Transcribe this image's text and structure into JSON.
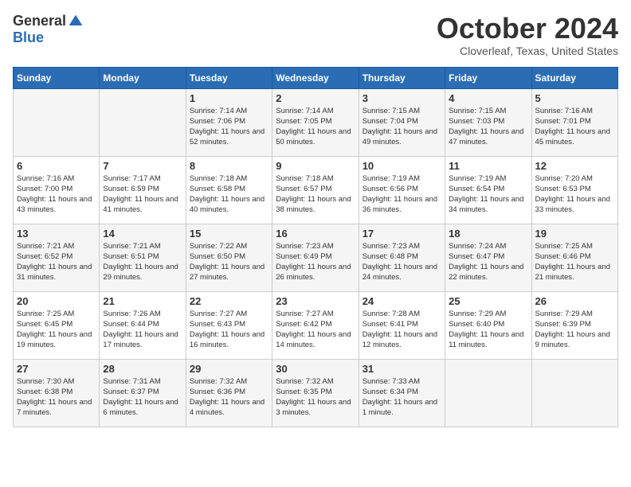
{
  "header": {
    "logo_general": "General",
    "logo_blue": "Blue",
    "month_title": "October 2024",
    "location": "Cloverleaf, Texas, United States"
  },
  "days_of_week": [
    "Sunday",
    "Monday",
    "Tuesday",
    "Wednesday",
    "Thursday",
    "Friday",
    "Saturday"
  ],
  "weeks": [
    [
      {
        "day": "",
        "info": ""
      },
      {
        "day": "",
        "info": ""
      },
      {
        "day": "1",
        "info": "Sunrise: 7:14 AM\nSunset: 7:06 PM\nDaylight: 11 hours and 52 minutes."
      },
      {
        "day": "2",
        "info": "Sunrise: 7:14 AM\nSunset: 7:05 PM\nDaylight: 11 hours and 50 minutes."
      },
      {
        "day": "3",
        "info": "Sunrise: 7:15 AM\nSunset: 7:04 PM\nDaylight: 11 hours and 49 minutes."
      },
      {
        "day": "4",
        "info": "Sunrise: 7:15 AM\nSunset: 7:03 PM\nDaylight: 11 hours and 47 minutes."
      },
      {
        "day": "5",
        "info": "Sunrise: 7:16 AM\nSunset: 7:01 PM\nDaylight: 11 hours and 45 minutes."
      }
    ],
    [
      {
        "day": "6",
        "info": "Sunrise: 7:16 AM\nSunset: 7:00 PM\nDaylight: 11 hours and 43 minutes."
      },
      {
        "day": "7",
        "info": "Sunrise: 7:17 AM\nSunset: 6:59 PM\nDaylight: 11 hours and 41 minutes."
      },
      {
        "day": "8",
        "info": "Sunrise: 7:18 AM\nSunset: 6:58 PM\nDaylight: 11 hours and 40 minutes."
      },
      {
        "day": "9",
        "info": "Sunrise: 7:18 AM\nSunset: 6:57 PM\nDaylight: 11 hours and 38 minutes."
      },
      {
        "day": "10",
        "info": "Sunrise: 7:19 AM\nSunset: 6:56 PM\nDaylight: 11 hours and 36 minutes."
      },
      {
        "day": "11",
        "info": "Sunrise: 7:19 AM\nSunset: 6:54 PM\nDaylight: 11 hours and 34 minutes."
      },
      {
        "day": "12",
        "info": "Sunrise: 7:20 AM\nSunset: 6:53 PM\nDaylight: 11 hours and 33 minutes."
      }
    ],
    [
      {
        "day": "13",
        "info": "Sunrise: 7:21 AM\nSunset: 6:52 PM\nDaylight: 11 hours and 31 minutes."
      },
      {
        "day": "14",
        "info": "Sunrise: 7:21 AM\nSunset: 6:51 PM\nDaylight: 11 hours and 29 minutes."
      },
      {
        "day": "15",
        "info": "Sunrise: 7:22 AM\nSunset: 6:50 PM\nDaylight: 11 hours and 27 minutes."
      },
      {
        "day": "16",
        "info": "Sunrise: 7:23 AM\nSunset: 6:49 PM\nDaylight: 11 hours and 26 minutes."
      },
      {
        "day": "17",
        "info": "Sunrise: 7:23 AM\nSunset: 6:48 PM\nDaylight: 11 hours and 24 minutes."
      },
      {
        "day": "18",
        "info": "Sunrise: 7:24 AM\nSunset: 6:47 PM\nDaylight: 11 hours and 22 minutes."
      },
      {
        "day": "19",
        "info": "Sunrise: 7:25 AM\nSunset: 6:46 PM\nDaylight: 11 hours and 21 minutes."
      }
    ],
    [
      {
        "day": "20",
        "info": "Sunrise: 7:25 AM\nSunset: 6:45 PM\nDaylight: 11 hours and 19 minutes."
      },
      {
        "day": "21",
        "info": "Sunrise: 7:26 AM\nSunset: 6:44 PM\nDaylight: 11 hours and 17 minutes."
      },
      {
        "day": "22",
        "info": "Sunrise: 7:27 AM\nSunset: 6:43 PM\nDaylight: 11 hours and 16 minutes."
      },
      {
        "day": "23",
        "info": "Sunrise: 7:27 AM\nSunset: 6:42 PM\nDaylight: 11 hours and 14 minutes."
      },
      {
        "day": "24",
        "info": "Sunrise: 7:28 AM\nSunset: 6:41 PM\nDaylight: 11 hours and 12 minutes."
      },
      {
        "day": "25",
        "info": "Sunrise: 7:29 AM\nSunset: 6:40 PM\nDaylight: 11 hours and 11 minutes."
      },
      {
        "day": "26",
        "info": "Sunrise: 7:29 AM\nSunset: 6:39 PM\nDaylight: 11 hours and 9 minutes."
      }
    ],
    [
      {
        "day": "27",
        "info": "Sunrise: 7:30 AM\nSunset: 6:38 PM\nDaylight: 11 hours and 7 minutes."
      },
      {
        "day": "28",
        "info": "Sunrise: 7:31 AM\nSunset: 6:37 PM\nDaylight: 11 hours and 6 minutes."
      },
      {
        "day": "29",
        "info": "Sunrise: 7:32 AM\nSunset: 6:36 PM\nDaylight: 11 hours and 4 minutes."
      },
      {
        "day": "30",
        "info": "Sunrise: 7:32 AM\nSunset: 6:35 PM\nDaylight: 11 hours and 3 minutes."
      },
      {
        "day": "31",
        "info": "Sunrise: 7:33 AM\nSunset: 6:34 PM\nDaylight: 11 hours and 1 minute."
      },
      {
        "day": "",
        "info": ""
      },
      {
        "day": "",
        "info": ""
      }
    ]
  ]
}
